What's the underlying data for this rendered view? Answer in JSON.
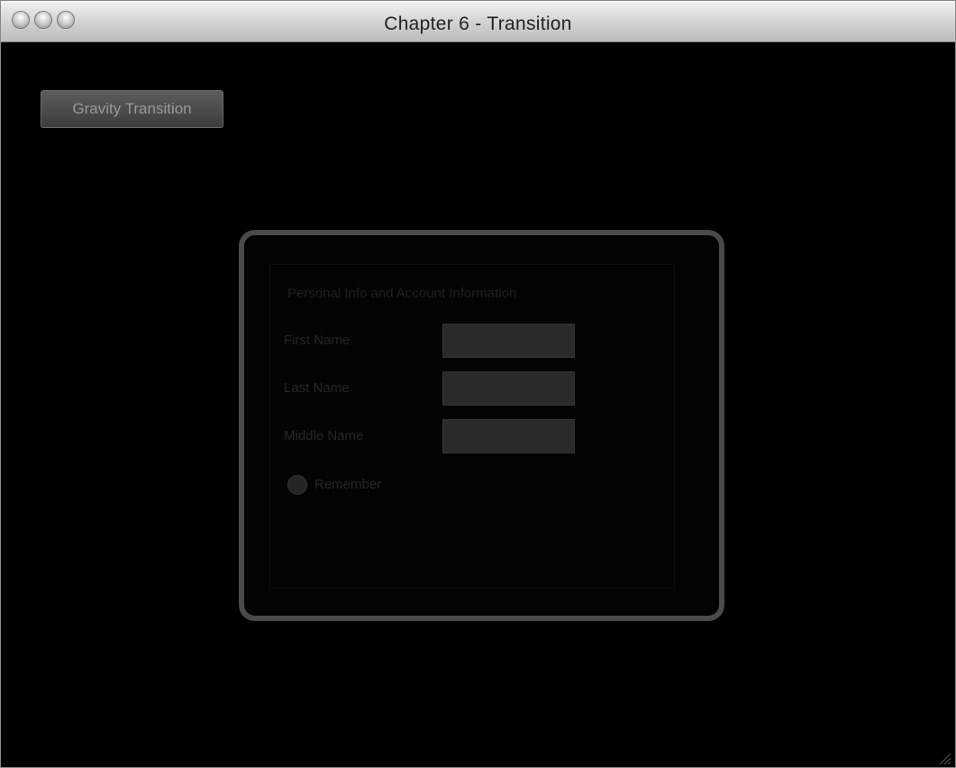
{
  "window": {
    "title": "Chapter 6 - Transition"
  },
  "toolbar": {
    "gravity_button_label": "Gravity Transition"
  },
  "dialog": {
    "heading": "Personal Info  and  Account Information",
    "fields": [
      {
        "label": "First Name",
        "value": ""
      },
      {
        "label": "Last Name",
        "value": ""
      },
      {
        "label": "Middle Name",
        "value": ""
      }
    ],
    "checkbox_label": "Remember",
    "checkbox_checked": false
  },
  "colors": {
    "background": "#000000",
    "dialog_border": "#4a4a4a",
    "input_fill": "#2a2a2a"
  }
}
